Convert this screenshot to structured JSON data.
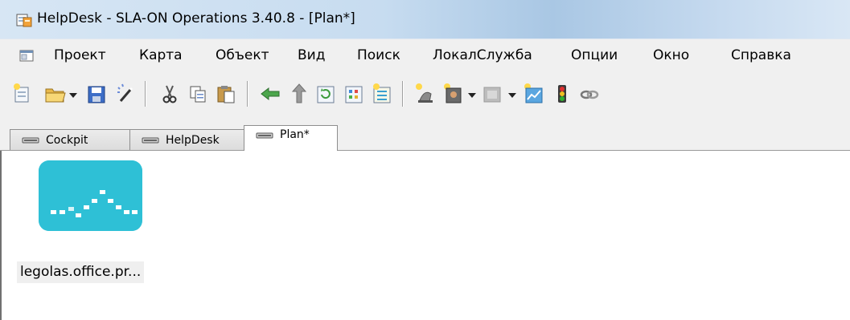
{
  "window": {
    "title": "HelpDesk - SLA-ON Operations 3.40.8 - [Plan*]",
    "app_icon": "helpdesk-app-icon"
  },
  "menu": {
    "items": [
      "Проект",
      "Карта",
      "Объект",
      "Вид",
      "Поиск",
      "ЛокалСлужба",
      "Опции",
      "Окно",
      "Справка"
    ]
  },
  "toolbar": {
    "buttons": [
      "new-icon",
      "open-folder-icon",
      "save-icon",
      "magic-wand-icon",
      "cut-icon",
      "copy-icon",
      "paste-icon",
      "back-arrow-icon",
      "up-arrow-icon",
      "refresh-icon",
      "grid-select-icon",
      "grid-highlight-icon",
      "new-agent-icon",
      "new-device-icon",
      "gray-window-icon",
      "chart-icon",
      "traffic-light-icon",
      "link-icon"
    ]
  },
  "tabs": {
    "items": [
      {
        "label": "Cockpit",
        "active": false
      },
      {
        "label": "HelpDesk",
        "active": false
      },
      {
        "label": "Plan*",
        "active": true
      }
    ]
  },
  "canvas": {
    "node": {
      "label": "legolas.office.pr...",
      "icon": "network-status-icon",
      "color": "#2ec0d6"
    }
  }
}
